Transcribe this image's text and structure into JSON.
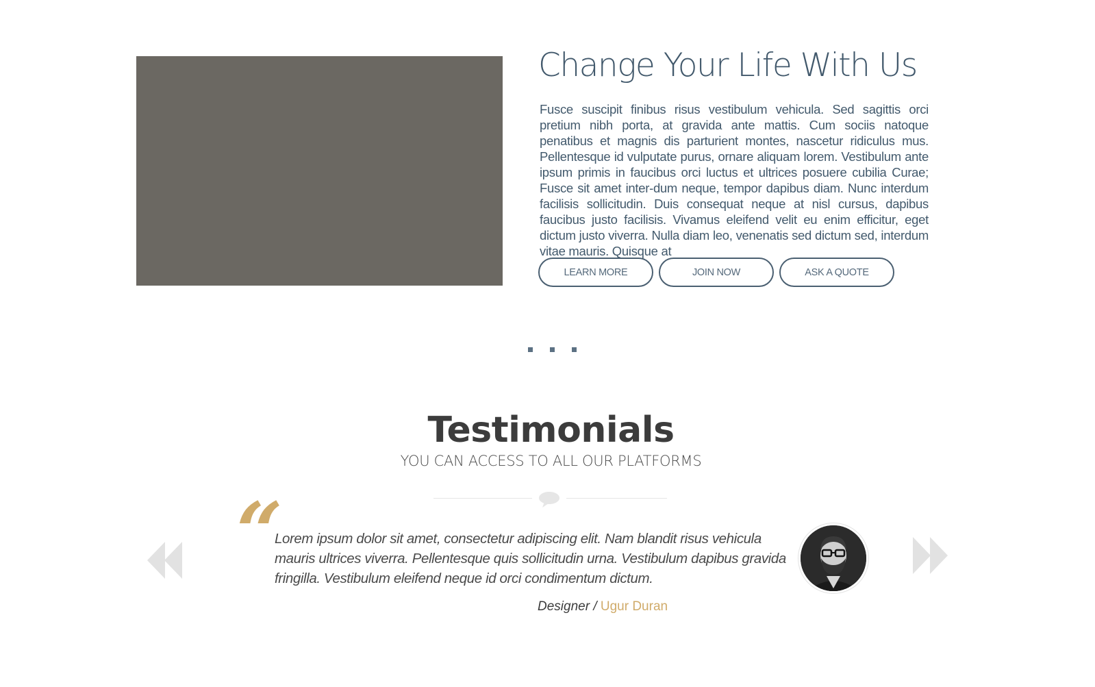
{
  "hero": {
    "image_color": "#6b6862",
    "title": "Change Your Life With Us",
    "paragraph": "Fusce suscipit finibus risus vestibulum vehicula. Sed sagittis orci pretium nibh porta, at gravida ante mattis. Cum sociis natoque penatibus et magnis dis parturient montes, nascetur ridiculus mus. Pellentesque id vulputate purus, ornare aliquam lorem. Vestibulum ante ipsum primis in faucibus orci luctus et ultrices posuere cubilia Curae; Fusce sit amet inter-dum neque, tempor dapibus diam. Nunc interdum facilisis sollicitudin. Duis consequat neque at nisl cursus, dapibus faucibus justo facilisis. Vivamus eleifend velit eu enim efficitur, eget dictum justo viverra. Nulla diam leo, venenatis sed dictum sed, interdum vitae mauris. Quisque at",
    "buttons": {
      "learn_more": "LEARN MORE",
      "join_now": "JOIN NOW",
      "ask_quote": "ASK A QUOTE"
    }
  },
  "pagination": {
    "dot_count": 3
  },
  "testimonials": {
    "title": "Testimonials",
    "subtitle": "YOU CAN ACCESS TO ALL OUR PLATFORMS",
    "divider_icon": "speech-bubble-icon",
    "quote_mark": "“",
    "quote": "Lorem ipsum dolor sit amet, consectetur adipiscing elit. Nam blandit risus vehicula mauris ultrices viverra. Pellentesque quis sollicitudin urna. Vestibulum dapibus gravida fringilla. Vestibulum eleifend neque id orci condimentum dictum.",
    "author_role": "Designer / ",
    "author_name": "Ugur Duran",
    "prev_icon": "double-chevron-left-icon",
    "next_icon": "double-chevron-right-icon"
  },
  "colors": {
    "primary": "#42596c",
    "accent": "#d0ab6a",
    "heading": "#3c3c3c",
    "arrow": "#e2e2e2"
  }
}
